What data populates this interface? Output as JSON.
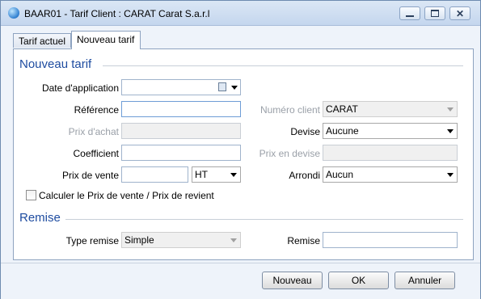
{
  "window": {
    "title": "BAAR01 - Tarif Client :  CARAT Carat S.a.r.l",
    "icon": "app-globe-icon"
  },
  "tabs": [
    {
      "label": "Tarif actuel",
      "active": false
    },
    {
      "label": "Nouveau tarif",
      "active": true
    }
  ],
  "sections": {
    "nouveau_tarif": "Nouveau tarif",
    "remise": "Remise"
  },
  "form": {
    "date_application": {
      "label": "Date d'application",
      "value": ""
    },
    "reference": {
      "label": "Référence",
      "value": ""
    },
    "numero_client": {
      "label": "Numéro client",
      "value": "CARAT"
    },
    "prix_achat": {
      "label": "Prix d'achat",
      "value": ""
    },
    "devise": {
      "label": "Devise",
      "value": "Aucune"
    },
    "coefficient": {
      "label": "Coefficient",
      "value": ""
    },
    "prix_en_devise": {
      "label": "Prix en devise",
      "value": ""
    },
    "prix_de_vente": {
      "label": "Prix de vente",
      "value": "",
      "unit": "HT"
    },
    "arrondi": {
      "label": "Arrondi",
      "value": "Aucun"
    },
    "calculer": {
      "label": "Calculer le Prix de vente / Prix de revient",
      "checked": false
    },
    "type_remise": {
      "label": "Type remise",
      "value": "Simple"
    },
    "remise": {
      "label": "Remise",
      "value": ""
    }
  },
  "buttons": {
    "nouveau": "Nouveau",
    "ok": "OK",
    "annuler": "Annuler"
  }
}
